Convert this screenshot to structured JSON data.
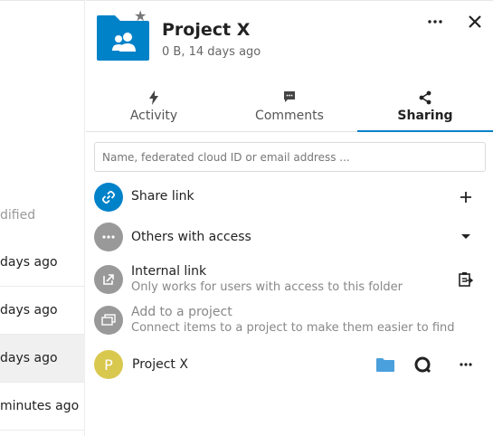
{
  "file_list": {
    "column_header": "dified",
    "rows": [
      {
        "modified": "days ago"
      },
      {
        "modified": "days ago"
      },
      {
        "modified": "days ago"
      },
      {
        "modified": "minutes ago"
      }
    ]
  },
  "sidebar": {
    "title": "Project X",
    "subtitle": "0 B, 14 days ago",
    "accent_color": "#0082c9",
    "tabs": [
      {
        "label": "Activity",
        "icon": "activity-icon"
      },
      {
        "label": "Comments",
        "icon": "comment-icon"
      },
      {
        "label": "Sharing",
        "icon": "share-icon",
        "active": true
      }
    ]
  },
  "sharing": {
    "input_placeholder": "Name, federated cloud ID or email address ...",
    "share_link": {
      "label": "Share link"
    },
    "others_with_access": {
      "label": "Others with access"
    },
    "internal_link": {
      "label": "Internal link",
      "description": "Only works for users with access to this folder"
    },
    "project": {
      "label": "Add to a project",
      "description": "Connect items to a project to make them easier to find"
    },
    "project_entry": {
      "label": "Project X",
      "avatar_letter": "P",
      "avatar_color": "#d9c84e"
    }
  }
}
